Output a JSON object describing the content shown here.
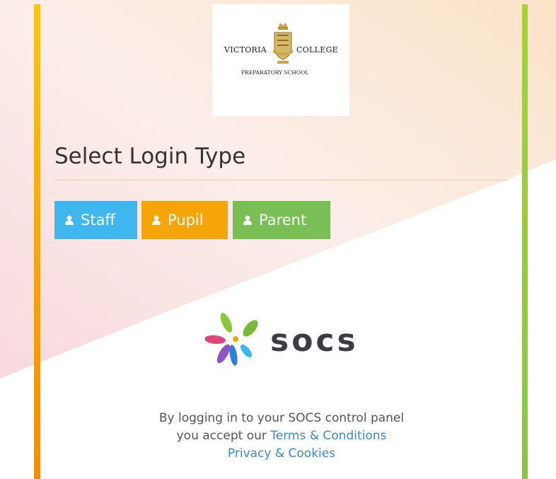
{
  "school": {
    "name_left": "VICTORIA",
    "name_right": "COLLEGE",
    "subtitle": "PREPARATORY SCHOOL"
  },
  "heading": "Select Login Type",
  "buttons": {
    "staff": "Staff",
    "pupil": "Pupil",
    "parent": "Parent"
  },
  "icons": {
    "button_icon": "user-icon",
    "brand_icon": "socs-petal-logo-icon"
  },
  "brand": {
    "name": "socs"
  },
  "footer": {
    "line1": "By logging in to your SOCS control panel",
    "line2_prefix": "you accept our",
    "terms_link": "Terms & Conditions",
    "privacy_link": "Privacy & Cookies"
  },
  "colors": {
    "staff": "#3fb6ee",
    "pupil": "#f5a50a",
    "parent": "#79bf55",
    "link": "#3b8ac9"
  }
}
